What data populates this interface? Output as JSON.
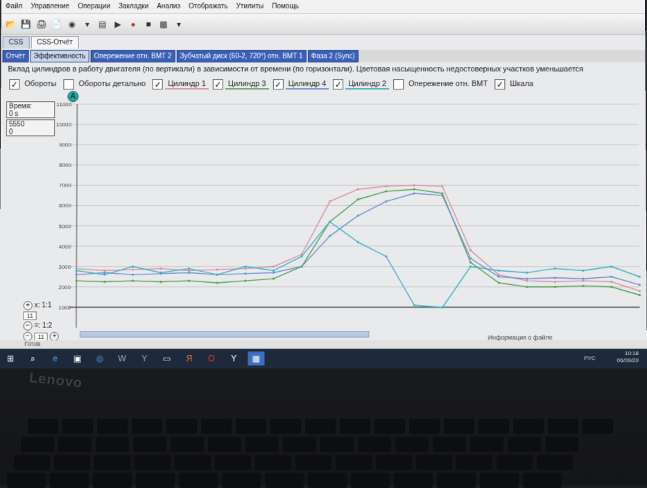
{
  "menu": [
    "Файл",
    "Управление",
    "Операции",
    "Закладки",
    "Анализ",
    "Отображать",
    "Утилиты",
    "Помощь"
  ],
  "doc_tabs": [
    {
      "label": "CSS",
      "active": false
    },
    {
      "label": "CSS-Отчёт",
      "active": true
    }
  ],
  "view_tabs": [
    {
      "label": "Отчёт",
      "active": false
    },
    {
      "label": "Эффективность",
      "active": true
    },
    {
      "label": "Опережение отн. ВМТ 2",
      "active": false
    },
    {
      "label": "Зубчатый диск (60-2, 720°) отн. ВМТ 1",
      "active": false
    },
    {
      "label": "Фаза 2 (Sync)",
      "active": false
    }
  ],
  "description": "Вклад цилиндров в работу двигателя (по вертикали) в зависимости от времени (по горизонтали). Цветовая насыщенность недостоверных участков уменьшается",
  "checkboxes": [
    {
      "label": "Обороты",
      "checked": true,
      "color": "#888888"
    },
    {
      "label": "Обороты детально",
      "checked": false,
      "color": "#888888"
    },
    {
      "label": "Цилиндр 1",
      "checked": true,
      "color": "#d98ea0"
    },
    {
      "label": "Цилиндр 3",
      "checked": true,
      "color": "#5aa85a"
    },
    {
      "label": "Цилиндр 4",
      "checked": true,
      "color": "#6a8fd0"
    },
    {
      "label": "Цилиндр 2",
      "checked": true,
      "color": "#3ab0c8"
    },
    {
      "label": "Опережение отн. ВМТ",
      "checked": false,
      "color": "#888888"
    },
    {
      "label": "Шкала",
      "checked": true,
      "color": "#888888"
    }
  ],
  "marker_label": "A",
  "time_box": {
    "label": "Время:",
    "value": "0 s"
  },
  "value_box": {
    "line1": "5550",
    "line2": "0"
  },
  "zoom": {
    "x_label": "x: 1:1",
    "x_value": "11",
    "y_label": "=: 1:2",
    "y_value": "11"
  },
  "status": {
    "left": "Готов",
    "right": "Информация о файле"
  },
  "taskbar": {
    "lang": "РУС",
    "time": "10:18",
    "date": "06/09/20"
  },
  "brand": "Lenovo",
  "chart_data": {
    "type": "line",
    "ylim": [
      0,
      11000
    ],
    "yticks": [
      1000,
      2000,
      3000,
      4000,
      5000,
      6000,
      7000,
      8000,
      9000,
      10000,
      11000
    ],
    "x": [
      0,
      5,
      10,
      15,
      20,
      25,
      30,
      35,
      40,
      45,
      50,
      55,
      60,
      65,
      70,
      75,
      80,
      85,
      90,
      95,
      100
    ],
    "series": [
      {
        "name": "Цилиндр 1",
        "color": "#d98ea0",
        "values": [
          2900,
          2800,
          2850,
          2900,
          2800,
          2850,
          2900,
          3000,
          3600,
          6200,
          6800,
          6950,
          7000,
          6950,
          3800,
          2600,
          2300,
          2250,
          2300,
          2250,
          1800
        ]
      },
      {
        "name": "Цилиндр 3",
        "color": "#4f9f4f",
        "values": [
          2300,
          2250,
          2300,
          2250,
          2300,
          2200,
          2300,
          2400,
          3000,
          5200,
          6300,
          6700,
          6800,
          6600,
          3200,
          2200,
          2000,
          2000,
          2050,
          2000,
          1600
        ]
      },
      {
        "name": "Цилиндр 4",
        "color": "#6a8fd0",
        "values": [
          2600,
          2700,
          2600,
          2650,
          2700,
          2600,
          2650,
          2700,
          3000,
          4500,
          5500,
          6200,
          6600,
          6500,
          3400,
          2500,
          2400,
          2450,
          2400,
          2500,
          2100
        ]
      },
      {
        "name": "Цилиндр 2",
        "color": "#3ab0c8",
        "values": [
          2800,
          2600,
          3000,
          2700,
          2900,
          2600,
          3000,
          2800,
          3500,
          5200,
          4200,
          3500,
          1100,
          1000,
          3000,
          2800,
          2700,
          2900,
          2800,
          3000,
          2500
        ]
      }
    ]
  }
}
